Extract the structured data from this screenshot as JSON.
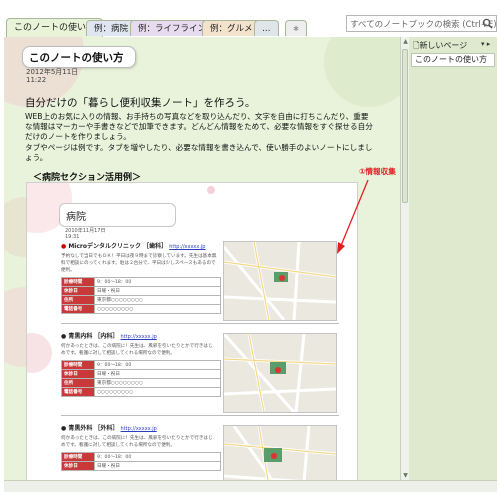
{
  "tabs": [
    {
      "label": "このノートの使い方",
      "active": true
    },
    {
      "label": "例：病院",
      "active": false
    },
    {
      "label": "例：ライフライン",
      "active": false
    },
    {
      "label": "例：グルメ",
      "active": false
    },
    {
      "label": "…",
      "active": false
    }
  ],
  "tab_add_label": "✱",
  "search": {
    "placeholder": "すべてのノートブックの検索 (Ctrl+E)",
    "icon": "magnifier-icon"
  },
  "page": {
    "title": "このノートの使い方",
    "date": "2012年5月11日",
    "time": "11:22",
    "heading": "自分だけの「暮らし便利収集ノート」を作ろう。",
    "body": "WEB上のお気に入りの情報、お手持ちの写真などを取り込んだり、文字を自由に打ちこんだり、重要な情報はマーカーや手書きなどで加筆できます。どんどん情報をためて、必要な情報をすぐ探せる自分だけのノートを作りましょう。\nタブやページは例です。タブを増やしたり、必要な情報を書き込んで、使い勝手のよいノートにしましょう。",
    "section_heading": "＜病院セクション活用例＞",
    "callout": "①情報収集"
  },
  "example": {
    "title": "病院",
    "date": "2010年11月17日",
    "time": "19:31",
    "clinics": [
      {
        "name": "Microデンタルクリニック",
        "kind": "［歯科］",
        "url": "http://xxxxx.jp",
        "desc": "予約なしで当日でもＯＫ！平日は夜９時まで診察しています。先生は基本無料で相談にのってくれます。駐は２台分で、平日は少しスペースもあるので便利。",
        "rows": [
          {
            "k": "診療時間",
            "v": "9：00～18：00"
          },
          {
            "k": "休診日",
            "v": "日曜・祝日"
          },
          {
            "k": "住所",
            "v": "東京都○○○○○○○○"
          },
          {
            "k": "電話番号",
            "v": "○○○○○○○○○"
          }
        ]
      },
      {
        "name": "● 青黒内科",
        "kind": "［内科］",
        "url": "http://xxxxx.jp",
        "desc": "何かあったときは、この病院に！先生は、風邪を引いたりとかで行きはじめです。看護に対して相談してくれる場所なので便利。",
        "rows": [
          {
            "k": "診療時間",
            "v": "9：00～18：00"
          },
          {
            "k": "休診日",
            "v": "日曜・祝日"
          },
          {
            "k": "住所",
            "v": "東京都○○○○○○○○"
          },
          {
            "k": "電話番号",
            "v": "○○○○○○○○○"
          }
        ]
      },
      {
        "name": "● 青黒外科",
        "kind": "［外科］",
        "url": "http://xxxxx.jp",
        "desc": "何かあったときは、この病院に！先生は、風邪を引いたりとかで行きはじめです。看護に対して相談してくれる場所なので便利。",
        "rows": [
          {
            "k": "診療時間",
            "v": "9：00～18：00"
          },
          {
            "k": "休診日",
            "v": "日曜・祝日"
          }
        ]
      }
    ]
  },
  "right_panel": {
    "new_page_label": "新しいページ",
    "pages": [
      "このノートの使い方"
    ]
  },
  "colors": {
    "accent_red": "#c93939",
    "callout_red": "#e02020",
    "page_bg": "#e9f3db"
  }
}
